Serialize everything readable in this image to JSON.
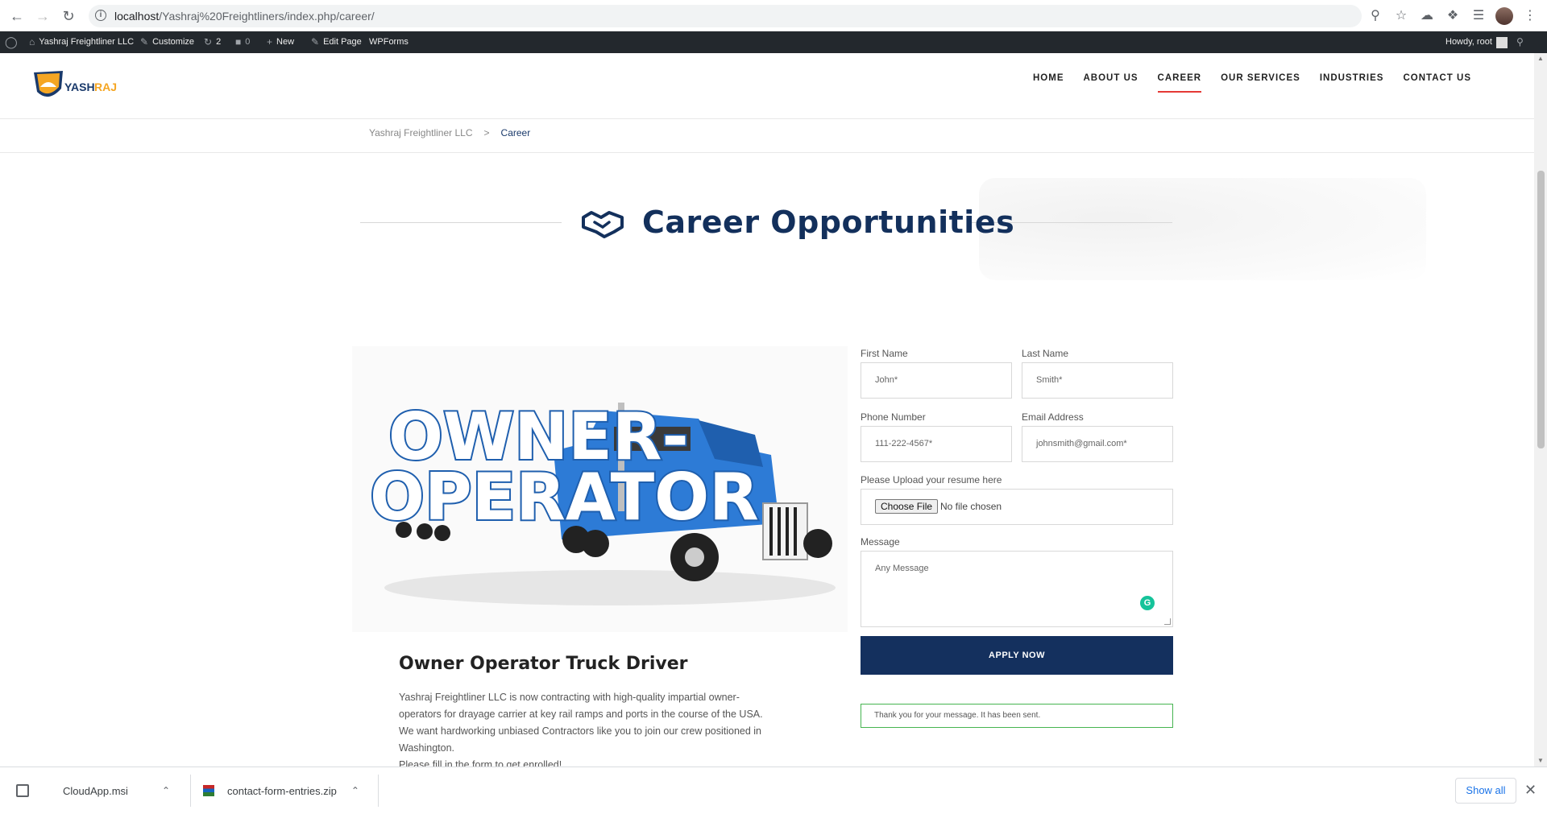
{
  "browser": {
    "url_host": "localhost",
    "url_path": "/Yashraj%20Freightliners/index.php/career/"
  },
  "admin_bar": {
    "site_name": "Yashraj Freightliner LLC",
    "customize": "Customize",
    "updates_count": "2",
    "comments_count": "0",
    "new": "New",
    "edit_page": "Edit Page",
    "wpforms": "WPForms",
    "howdy": "Howdy, root"
  },
  "header": {
    "logo_text": "YASHRAJ",
    "nav": [
      "HOME",
      "ABOUT US",
      "CAREER",
      "OUR SERVICES",
      "INDUSTRIES",
      "CONTACT US"
    ],
    "active_nav": "CAREER"
  },
  "breadcrumb": {
    "home": "Yashraj Freightliner LLC",
    "separator": ">",
    "current": "Career"
  },
  "page": {
    "title": "Career Opportunities"
  },
  "job": {
    "image_text_line1": "OWNER-",
    "image_text_line2": "OPERATOR",
    "title": "Owner Operator Truck Driver",
    "description_lines": [
      "Yashraj Freightliner LLC is now contracting with high-quality impartial owner-",
      "operators for drayage carrier at key rail ramps and ports in the course of the USA.",
      "We want hardworking unbiased Contractors like you to join our crew positioned in",
      "Washington.",
      "Please fill in the form to get enrolled!"
    ]
  },
  "form": {
    "first_name_label": "First Name",
    "first_name_placeholder": "John*",
    "last_name_label": "Last Name",
    "last_name_placeholder": "Smith*",
    "phone_label": "Phone Number",
    "phone_placeholder": "111-222-4567*",
    "email_label": "Email Address",
    "email_placeholder": "johnsmith@gmail.com*",
    "resume_label": "Please Upload your resume here",
    "choose_file": "Choose File",
    "no_file": "No file chosen",
    "message_label": "Message",
    "message_placeholder": "Any Message",
    "submit": "APPLY NOW",
    "success": "Thank you for your message. It has been sent."
  },
  "downloads": {
    "items": [
      "CloudApp.msi",
      "contact-form-entries.zip"
    ],
    "show_all": "Show all"
  },
  "colors": {
    "brand_navy": "#14305e",
    "accent_red": "#e53935",
    "success_green": "#46b450"
  }
}
